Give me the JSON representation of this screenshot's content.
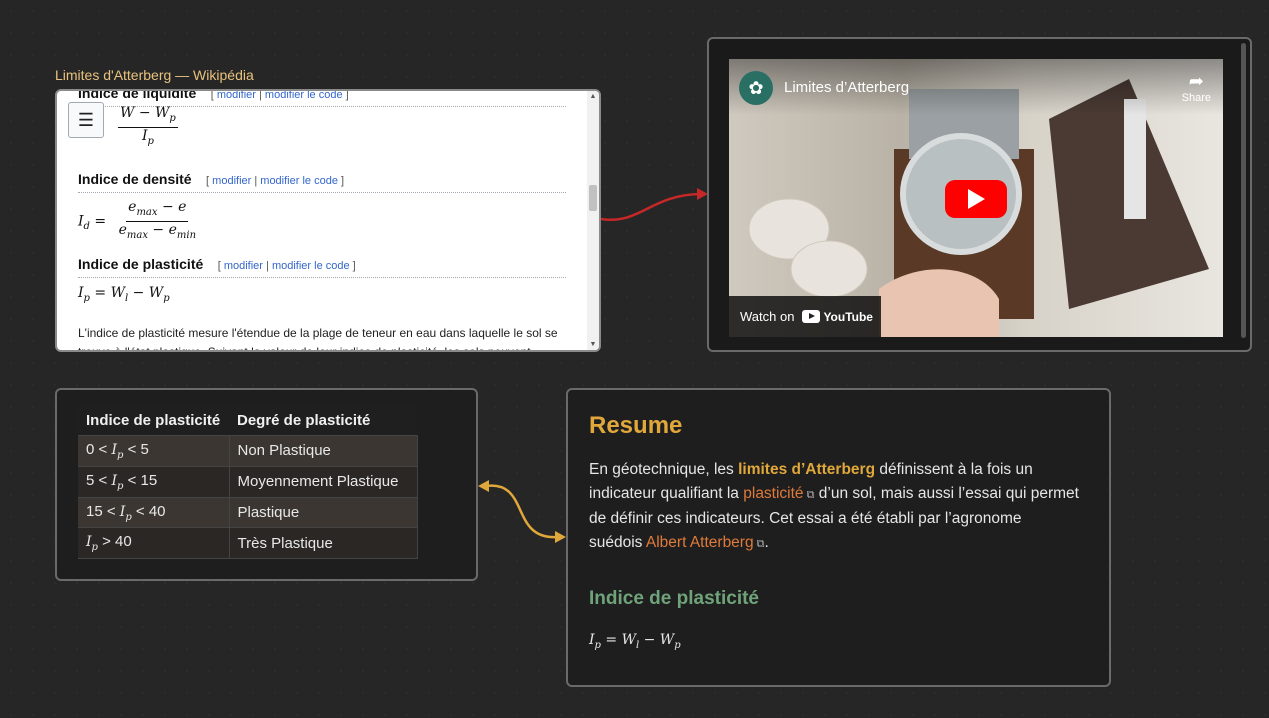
{
  "web": {
    "label": "Limites d'Atterberg — Wikipédia",
    "partial_heading": "Indice de liquidité",
    "edit_modifier": "modifier",
    "edit_sep": "|",
    "edit_code": "modifier le code",
    "sections": [
      {
        "title": "Indice de densité"
      },
      {
        "title": "Indice de plasticité"
      }
    ],
    "paragraph": "L'indice de plasticité mesure l'étendue de la plage de teneur en eau dans laquelle le sol se trouve à l'état plastique. Suivant la valeur de leur indice de plasticité, les sols peuvent"
  },
  "video": {
    "title": "Limites d’Atterberg",
    "share": "Share",
    "watch_on": "Watch on",
    "youtube": "YouTube"
  },
  "table": {
    "headers": [
      "Indice de plasticité",
      "Degré de plasticité"
    ],
    "rows": [
      {
        "pre": "0 <",
        "post": "< 5",
        "degree": "Non Plastique"
      },
      {
        "pre": "5 <",
        "post": "< 15",
        "degree": "Moyennement Plastique"
      },
      {
        "pre": "15 <",
        "post": "< 40",
        "degree": "Plastique"
      },
      {
        "pre": "",
        "post": "> 40",
        "degree": "Très Plastique"
      }
    ]
  },
  "resume": {
    "title": "Resume",
    "p1": "En géotechnique, les ",
    "bold": "limites d’Atterberg",
    "p2": " définissent à la fois un indicateur qualifiant la ",
    "link1": "plasticité",
    "p3": " d’un sol, mais aussi l’essai qui permet de définir ces indicateurs. Cet essai a été établi par l’agronome suédois ",
    "link2": "Albert Atterberg",
    "p4": ".",
    "subheading": "Indice de plasticité"
  },
  "colors": {
    "accent": "#e0a73b",
    "link": "#e07a3b",
    "green": "#6fa37a",
    "edge_red": "#c62828",
    "edge_yellow": "#e0a73b"
  }
}
